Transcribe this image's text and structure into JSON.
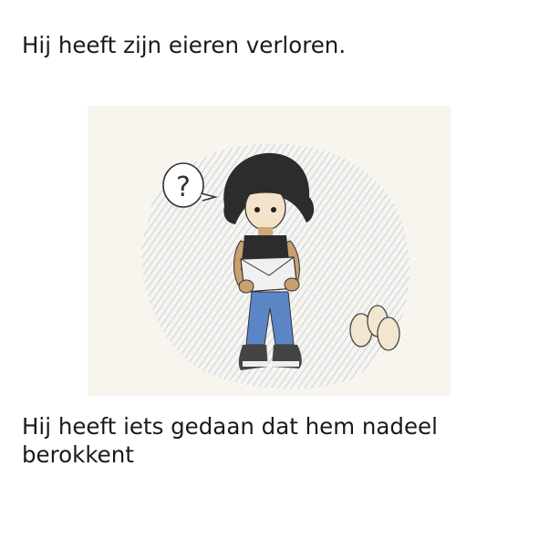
{
  "title": "Hij heeft zijn eieren verloren.",
  "subtitle": "Hij heeft iets gedaan dat hem nadeel berokkent",
  "illustration": {
    "speech_bubble_text": "?",
    "paper_color": "#f7f4ec",
    "shading_color": "#b9c8e4",
    "hair_color": "#2a2a2a",
    "jeans_color": "#5b86c6",
    "egg_color": "#f2e6d0"
  }
}
